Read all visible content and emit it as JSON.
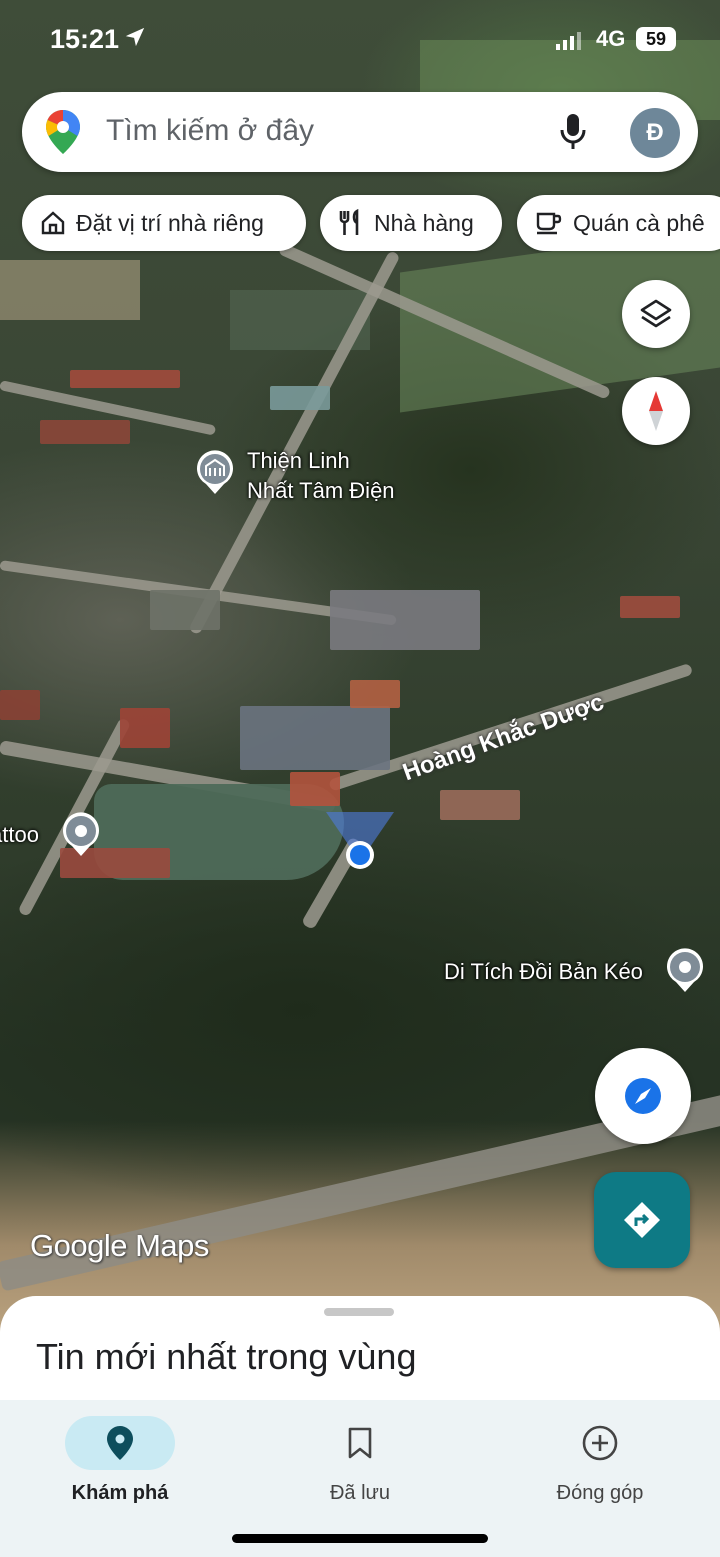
{
  "status_bar": {
    "time": "15:21",
    "network": "4G",
    "battery": "59"
  },
  "search": {
    "placeholder": "Tìm kiếm ở đây",
    "avatar_initial": "Đ"
  },
  "chips": [
    {
      "label": "Đặt vị trí nhà riêng",
      "icon": "home-icon"
    },
    {
      "label": "Nhà hàng",
      "icon": "restaurant-icon"
    },
    {
      "label": "Quán cà phê",
      "icon": "coffee-icon"
    }
  ],
  "map": {
    "places": [
      {
        "name_line1": "Thiện Linh",
        "name_line2": "Nhất Tâm Điện",
        "icon": "temple-icon"
      },
      {
        "name": "attoo",
        "icon": "place-pin-icon"
      },
      {
        "name": "Di Tích Đồi Bản Kéo",
        "icon": "place-pin-icon"
      }
    ],
    "street": "Hoàng Khắc Dược",
    "logo": "Google Maps"
  },
  "sheet": {
    "title": "Tin mới nhất trong vùng"
  },
  "nav": [
    {
      "label": "Khám phá",
      "icon": "location-pin-icon",
      "active": true
    },
    {
      "label": "Đã lưu",
      "icon": "bookmark-icon",
      "active": false
    },
    {
      "label": "Đóng góp",
      "icon": "add-circle-icon",
      "active": false
    }
  ],
  "colors": {
    "accent": "#0e7a85",
    "nav_active": "#c9eaf3",
    "location_blue": "#1a73e8"
  }
}
